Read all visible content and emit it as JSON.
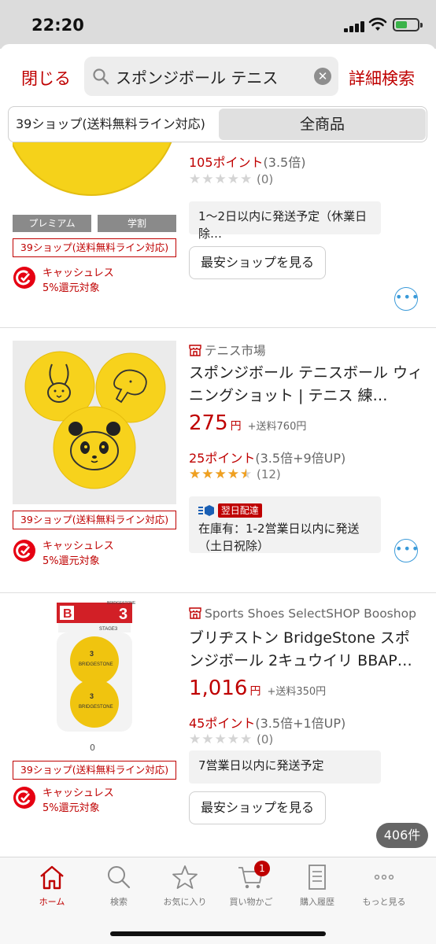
{
  "status_bar": {
    "time": "22:20"
  },
  "header": {
    "close_label": "閉じる",
    "search_value": "スポンジボール テニス",
    "detail_label": "詳細検索"
  },
  "segment": {
    "left": "39ショップ(送料無料ライン対応)",
    "right": "全商品"
  },
  "items": [
    {
      "tags": [
        "プレミアム",
        "学割"
      ],
      "badge39": "39ショップ(送料無料ライン対応)",
      "cashless": [
        "キャッシュレス",
        "5%還元対象"
      ],
      "points": "105ポイント",
      "points_mult": "(3.5倍)",
      "rating_fraction": 0,
      "rating_count": "(0)",
      "shipping": "1〜2日以内に発送予定（休業日除…",
      "compare_label": "最安ショップを見る"
    },
    {
      "shop": "テニス市場",
      "title": "スポンジボール テニスボール ウィニングショット | テニス 練…",
      "price": "275",
      "yen": "円",
      "shipping_fee": "+送料760円",
      "badge39": "39ショップ(送料無料ライン対応)",
      "cashless": [
        "キャッシュレス",
        "5%還元対象"
      ],
      "points": "25ポイント",
      "points_mult": "(3.5倍+9倍UP)",
      "rating_fraction": 0.9,
      "rating_count": "(12)",
      "nextday": "翌日配達",
      "shipping": "在庫有：1-2営業日以内に発送（土日祝除）"
    },
    {
      "shop": "Sports Shoes SelectSHOP Booshop",
      "title": "ブリヂストン BridgeStone スポンジボール 2キュウイリ BBAP…",
      "price": "1,016",
      "yen": "円",
      "shipping_fee": "+送料350円",
      "image_caption": "0",
      "badge39": "39ショップ(送料無料ライン対応)",
      "cashless": [
        "キャッシュレス",
        "5%還元対象"
      ],
      "points": "45ポイント",
      "points_mult": "(3.5倍+1倍UP)",
      "rating_fraction": 0,
      "rating_count": "(0)",
      "shipping": "7営業日以内に発送予定",
      "compare_label": "最安ショップを見る",
      "package_brand": "BRIDGESTONE",
      "package_num": "3",
      "package_stage": "STAGE3"
    }
  ],
  "result_count": "406件",
  "tabbar": {
    "tabs": [
      {
        "label": "ホーム",
        "icon": "home-icon"
      },
      {
        "label": "検索",
        "icon": "search-icon"
      },
      {
        "label": "お気に入り",
        "icon": "star-icon"
      },
      {
        "label": "買い物かご",
        "icon": "cart-icon"
      },
      {
        "label": "購入履歴",
        "icon": "history-icon"
      },
      {
        "label": "もっと見る",
        "icon": "more-icon"
      }
    ],
    "cart_count": "1"
  },
  "colors": {
    "accent": "#bf0000",
    "link": "#3a9ad9",
    "star": "#f0a020",
    "ball": "#f5d21a"
  }
}
